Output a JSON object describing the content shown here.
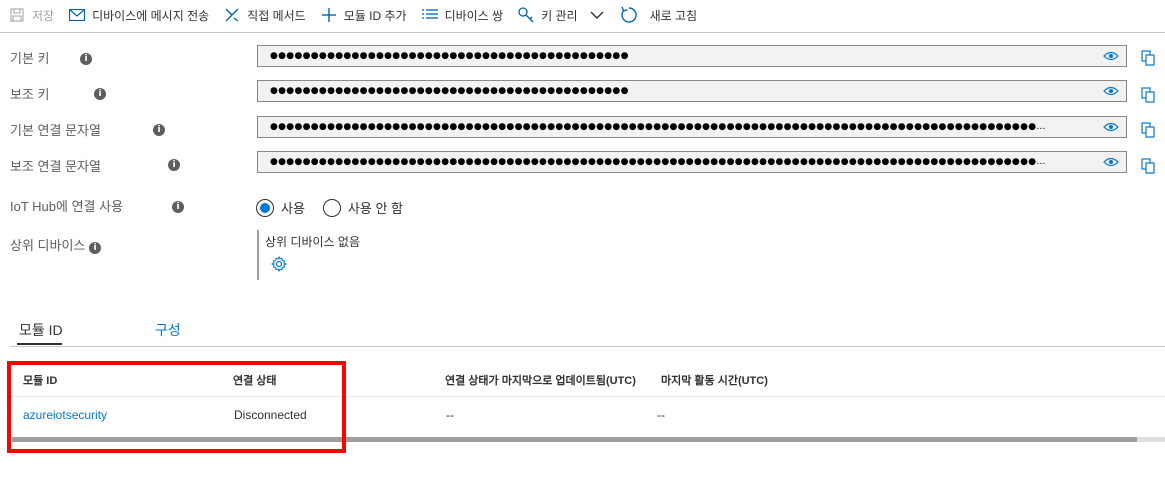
{
  "toolbar": {
    "save": "저장",
    "send_message": "디바이스에 메시지 전송",
    "direct_method": "직접 메서드",
    "add_module_id": "모듈 ID 추가",
    "device_twin": "디바이스 쌍",
    "key_management": "키 관리",
    "refresh": "새로 고침"
  },
  "fields": {
    "primary_key_label": "기본 키",
    "secondary_key_label": "보조 키",
    "primary_conn_label": "기본 연결 문자열",
    "secondary_conn_label": "보조 연결 문자열",
    "iot_hub_label": "IoT Hub에 연결 사용",
    "parent_device_label": "상위 디바이스",
    "primary_key_value": "●●●●●●●●●●●●●●●●●●●●●●●●●●●●●●●●●●●●●●●●●●●●",
    "secondary_key_value": "●●●●●●●●●●●●●●●●●●●●●●●●●●●●●●●●●●●●●●●●●●●●",
    "primary_conn_value": "●●●●●●●●●●●●●●●●●●●●●●●●●●●●●●●●●●●●●●●●●●●●●●●●●●●●●●●●●●●●●●●●●●●●●●●●●●●●●●●●●●●●●●●●●●●●●●…",
    "secondary_conn_value": "●●●●●●●●●●●●●●●●●●●●●●●●●●●●●●●●●●●●●●●●●●●●●●●●●●●●●●●●●●●●●●●●●●●●●●●●●●●●●●●●●●●●●●●●●●●●●●…",
    "enable_option": "사용",
    "disable_option": "사용 안 함",
    "selected_option": "사용",
    "parent_device_value": "상위 디바이스 없음"
  },
  "tabs": [
    {
      "label": "모듈 ID",
      "active": true
    },
    {
      "label": "구성",
      "active": false
    }
  ],
  "table": {
    "headers": [
      "모듈 ID",
      "연결 상태",
      "연결 상태가 마지막으로 업데이트됨(UTC)",
      "마지막 활동 시간(UTC)"
    ],
    "rows": [
      [
        "azureiotsecurity",
        "Disconnected",
        "--",
        "--"
      ]
    ]
  },
  "colors": {
    "accent": "#0078d4",
    "highlight": "#ff0000"
  },
  "icons": [
    "save-icon",
    "mail-icon",
    "direct-method-icon",
    "plus-icon",
    "list-icon",
    "key-icon",
    "chevron-down-icon",
    "refresh-icon",
    "eye-icon",
    "copy-icon",
    "info-icon",
    "gear-icon"
  ]
}
